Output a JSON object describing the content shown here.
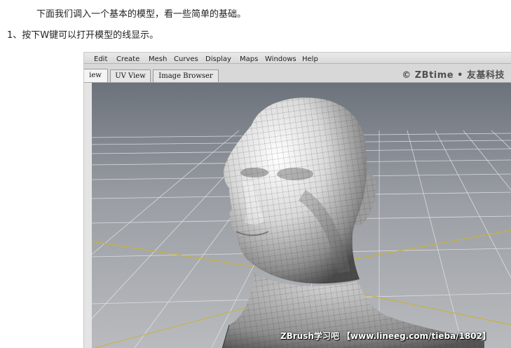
{
  "article": {
    "intro": "下面我们调入一个基本的模型，看一些简单的基础。",
    "step1": "1、按下W键可以打开模型的线显示。"
  },
  "screenshot": {
    "menu_items": [
      "Edit",
      "Create",
      "Mesh",
      "Curves",
      "Display",
      "Maps",
      "Windows",
      "Help"
    ],
    "tabs": [
      {
        "label": "iew",
        "active": true
      },
      {
        "label": "UV View",
        "active": false
      },
      {
        "label": "Image Browser",
        "active": false
      }
    ],
    "watermark_top": "© ZBtime • 友基科技",
    "watermark_bottom": "ZBrush学习吧 【www.lineeg.com/tieba/1802】"
  }
}
